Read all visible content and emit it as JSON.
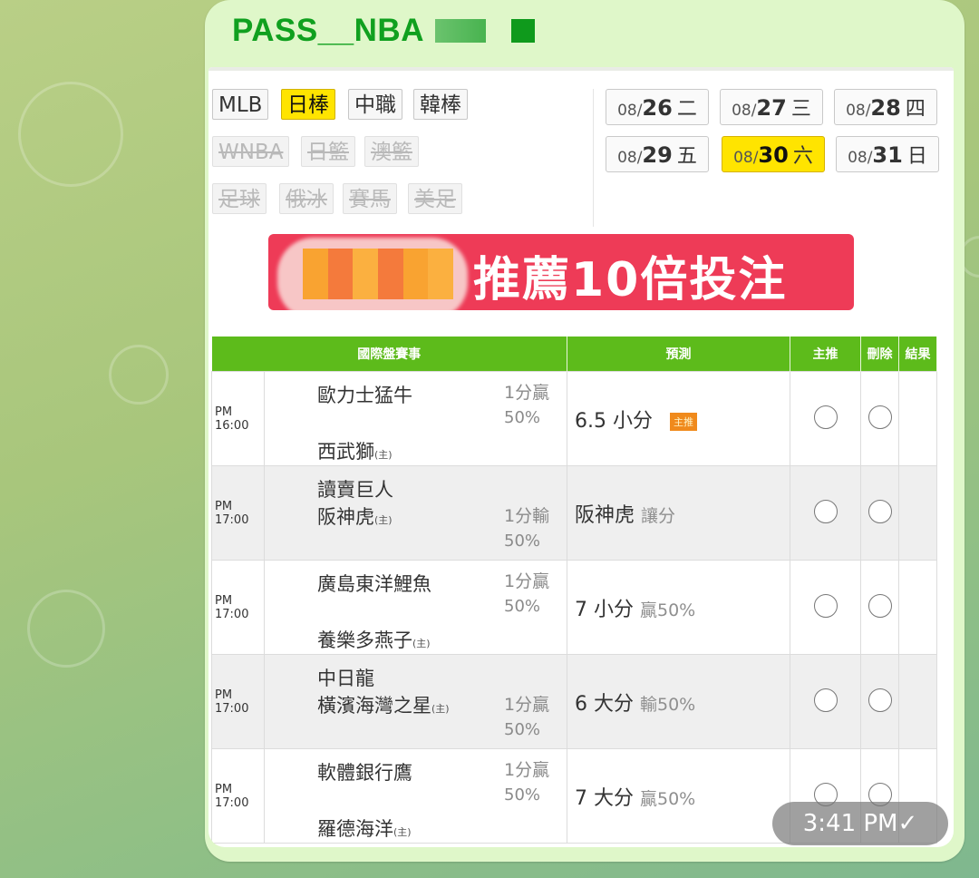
{
  "chat": {
    "sender": "PASS__NBA"
  },
  "leagues": {
    "row1": [
      {
        "label": "MLB",
        "state": "normal"
      },
      {
        "label": "日棒",
        "state": "active"
      },
      {
        "label": "中職",
        "state": "normal"
      },
      {
        "label": "韓棒",
        "state": "normal"
      }
    ],
    "row2": [
      {
        "label": "WNBA",
        "state": "disabled"
      },
      {
        "label": "日籃",
        "state": "disabled"
      },
      {
        "label": "澳籃",
        "state": "disabled"
      }
    ],
    "row3": [
      {
        "label": "足球",
        "state": "disabled"
      },
      {
        "label": "俄冰",
        "state": "disabled"
      },
      {
        "label": "賽馬",
        "state": "disabled"
      },
      {
        "label": "美足",
        "state": "disabled"
      }
    ]
  },
  "dates": [
    {
      "month": "08/",
      "day": "26",
      "dow": "二",
      "active": false
    },
    {
      "month": "08/",
      "day": "27",
      "dow": "三",
      "active": false
    },
    {
      "month": "08/",
      "day": "28",
      "dow": "四",
      "active": false
    },
    {
      "month": "08/",
      "day": "29",
      "dow": "五",
      "active": false
    },
    {
      "month": "08/",
      "day": "30",
      "dow": "六",
      "active": true
    },
    {
      "month": "08/",
      "day": "31",
      "dow": "日",
      "active": false
    }
  ],
  "banner": {
    "text": "推薦10倍投注"
  },
  "table": {
    "headers": {
      "event": "國際盤賽事",
      "prediction": "預測",
      "recommend": "主推",
      "delete": "刪除",
      "result": "結果"
    },
    "host_mark": "(主)",
    "rows": [
      {
        "time": "PM 16:00",
        "away": "歐力士猛牛",
        "home": "西武獅",
        "line": "1分贏",
        "pct": "50%",
        "pick": "6.5 小分",
        "pick_sub": "",
        "badge": "主推",
        "layout": "spread"
      },
      {
        "time": "PM 17:00",
        "away": "讀賣巨人",
        "home": "阪神虎",
        "line": "1分輸",
        "pct": "50%",
        "pick": "阪神虎",
        "pick_sub": "讓分",
        "badge": "",
        "layout": "tight"
      },
      {
        "time": "PM 17:00",
        "away": "廣島東洋鯉魚",
        "home": "養樂多燕子",
        "line": "1分贏",
        "pct": "50%",
        "pick": "7 小分",
        "pick_sub": "贏50%",
        "badge": "",
        "layout": "spread"
      },
      {
        "time": "PM 17:00",
        "away": "中日龍",
        "home": "橫濱海灣之星",
        "line": "1分贏",
        "pct": "50%",
        "pick": "6 大分",
        "pick_sub": "輸50%",
        "badge": "",
        "layout": "tight"
      },
      {
        "time": "PM 17:00",
        "away": "軟體銀行鷹",
        "home": "羅德海洋",
        "line": "1分贏",
        "pct": "50%",
        "pick": "7 大分",
        "pick_sub": "贏50%",
        "badge": "",
        "layout": "spread"
      }
    ]
  },
  "message": {
    "time": "3:41 PM",
    "status": "✓"
  },
  "colors": {
    "header_green": "#5dbb1b",
    "active_yellow": "#ffe400",
    "banner_red": "#ee3b57",
    "sender_green": "#10a01f"
  }
}
